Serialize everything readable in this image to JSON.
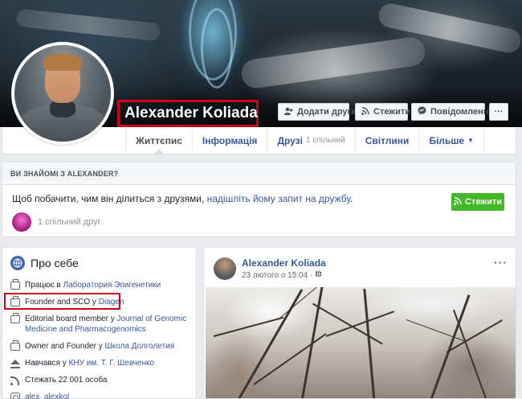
{
  "profile": {
    "name": "Alexander Koliada"
  },
  "cover_actions": {
    "add_friend": "Додати друга",
    "follow": "Стежити",
    "message": "Повідомлення",
    "more": "···"
  },
  "tabs": [
    {
      "label": "Життєпис",
      "extra": ""
    },
    {
      "label": "Інформація",
      "extra": ""
    },
    {
      "label": "Друзі",
      "extra": "1 спільний"
    },
    {
      "label": "Світлини",
      "extra": ""
    },
    {
      "label": "Більше",
      "extra": ""
    }
  ],
  "know_card": {
    "heading": "ВИ ЗНАЙОМІ З ALEXANDER?",
    "text_before": "Щоб побачити, чим він ділиться з друзями, ",
    "link": "надішліть йому запит на дружбу",
    "text_after": ".",
    "follow_button": "Стежити",
    "mutual": "1 спільний друг"
  },
  "about": {
    "title": "Про себе",
    "items": [
      {
        "icon": "briefcase-icon",
        "prefix": "Працює в ",
        "link": "Лаборатория Эпигенетики",
        "suffix": ""
      },
      {
        "icon": "briefcase-icon",
        "prefix": "Founder and SCO у ",
        "link": "Diagen",
        "suffix": ""
      },
      {
        "icon": "briefcase-icon",
        "prefix": "Editorial board member у ",
        "link": "Journal of Genomic Medicine and Pharmacogenomics",
        "suffix": ""
      },
      {
        "icon": "briefcase-icon",
        "prefix": "Owner and Founder у ",
        "link": "Школа Долголетия",
        "suffix": ""
      },
      {
        "icon": "graduation-cap-icon",
        "prefix": "Навчався у ",
        "link": "КНУ им. Т. Г. Шевченко",
        "suffix": ""
      },
      {
        "icon": "rss-icon",
        "prefix": "Стежать 22 001 особа",
        "link": "",
        "suffix": ""
      },
      {
        "icon": "instagram-icon",
        "prefix": "alex_alexkol",
        "link": "",
        "suffix": ""
      }
    ]
  },
  "post": {
    "author": "Alexander Koliada",
    "date": "23 лютого о 15:04 ·",
    "audience_icon": "globe-icon",
    "more": "···"
  },
  "colors": {
    "link": "#365899",
    "follow_green": "#42b72a",
    "highlight_red": "#d0021b"
  }
}
